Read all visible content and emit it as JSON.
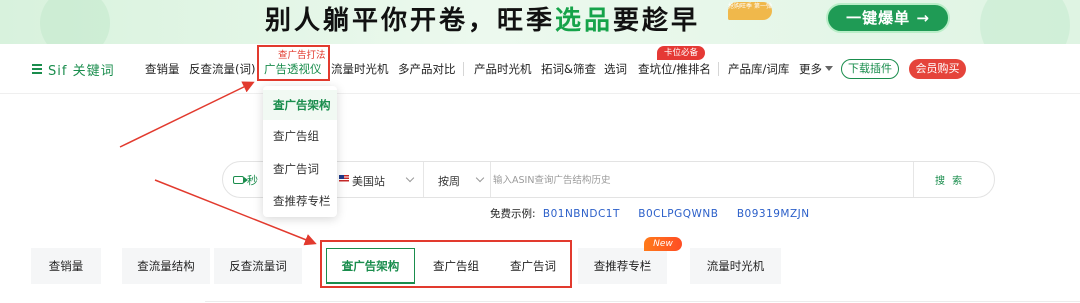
{
  "banner": {
    "title_prefix": "别人躺平你开卷，旺季",
    "title_highlight": "选品",
    "title_suffix": "要趁早",
    "badge": "抢购旺季 第一弹",
    "cta": "一键爆单 →"
  },
  "nav": {
    "logo": "Sif 关键词",
    "items": [
      {
        "label": "查销量"
      },
      {
        "label": "反查流量(词)"
      },
      {
        "label": "广告透视仪"
      },
      {
        "label": "流量时光机"
      },
      {
        "label": "多产品对比"
      },
      {
        "label": "产品时光机"
      },
      {
        "label": "拓词&筛查"
      },
      {
        "label": "选词"
      },
      {
        "label": "查坑位/推排名"
      },
      {
        "label": "产品库/词库"
      },
      {
        "label": "更多"
      }
    ],
    "hot_badge": "卡位必备",
    "annotation": "查广告打法",
    "download_button": "下载插件",
    "vip_button": "会员购买"
  },
  "dropdown": {
    "items": [
      "查广告架构",
      "查广告组",
      "查广告词",
      "查推荐专栏"
    ]
  },
  "search": {
    "mode": "秒",
    "site": "美国站",
    "period": "按周",
    "placeholder": "输入ASIN查询广告结构历史",
    "button": "搜 索"
  },
  "examples": {
    "label": "免费示例:",
    "asins": [
      "B01NBNDC1T",
      "B0CLPGQWNB",
      "B09319MZJN"
    ]
  },
  "tabs": [
    {
      "label": "查销量"
    },
    {
      "label": "查流量结构"
    },
    {
      "label": "反查流量词"
    },
    {
      "label": "查广告架构"
    },
    {
      "label": "查广告组"
    },
    {
      "label": "查广告词"
    },
    {
      "label": "查推荐专栏"
    },
    {
      "label": "流量时光机"
    }
  ],
  "new_badge": "New",
  "colors": {
    "brand_green": "#1a8d4d",
    "annotation_red": "#e23a2e",
    "link_blue": "#2b5fc9",
    "vip_red": "#e5443b"
  }
}
